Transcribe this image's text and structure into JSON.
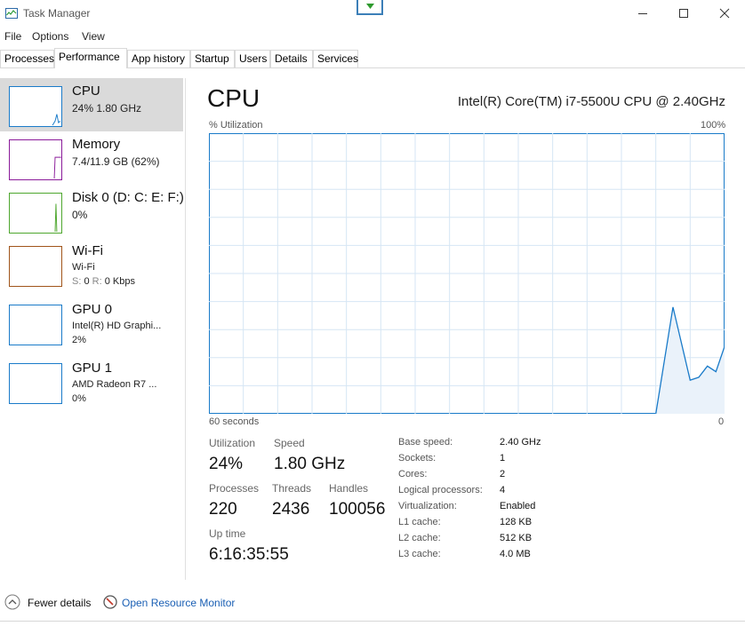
{
  "window": {
    "title": "Task Manager"
  },
  "menu": [
    "File",
    "Options",
    "View"
  ],
  "tabs": [
    "Processes",
    "Performance",
    "App history",
    "Startup",
    "Users",
    "Details",
    "Services"
  ],
  "sidebar": [
    {
      "name": "CPU",
      "line1": "24%  1.80 GHz",
      "color": "#1a7bc9"
    },
    {
      "name": "Memory",
      "line1": "7.4/11.9 GB (62%)",
      "color": "#8b1b9a"
    },
    {
      "name": "Disk 0 (D: C: E: F:)",
      "line1": "0%",
      "color": "#4ea72e"
    },
    {
      "name": "Wi-Fi",
      "line1": "Wi-Fi",
      "line2_s": "S:",
      "line2_sv": "0",
      "line2_r": "R:",
      "line2_rv": "0 Kbps",
      "color": "#a0541a"
    },
    {
      "name": "GPU 0",
      "line1": "Intel(R) HD Graphi...",
      "line2": "2%",
      "color": "#1a7bc9"
    },
    {
      "name": "GPU 1",
      "line1": "AMD Radeon R7 ...",
      "line2": "0%",
      "color": "#1a7bc9"
    }
  ],
  "main": {
    "title": "CPU",
    "model": "Intel(R) Core(TM) i7-5500U CPU @ 2.40GHz",
    "util_label": "% Utilization",
    "util_max": "100%",
    "time_label": "60 seconds",
    "time_zero": "0"
  },
  "chart_data": {
    "type": "area",
    "title": "CPU",
    "ylabel": "% Utilization",
    "xlabel": "60 seconds",
    "ylim": [
      0,
      100
    ],
    "x_seconds_ago": [
      8,
      6,
      4,
      3,
      2,
      1,
      0
    ],
    "values": [
      0,
      38,
      12,
      13,
      17,
      15,
      24
    ],
    "grid": true,
    "color": "#1a7bc9"
  },
  "stats": {
    "utilization_label": "Utilization",
    "utilization": "24%",
    "speed_label": "Speed",
    "speed": "1.80 GHz",
    "processes_label": "Processes",
    "processes": "220",
    "threads_label": "Threads",
    "threads": "2436",
    "handles_label": "Handles",
    "handles": "100056",
    "uptime_label": "Up time",
    "uptime": "6:16:35:55"
  },
  "specs": [
    {
      "label": "Base speed:",
      "value": "2.40 GHz"
    },
    {
      "label": "Sockets:",
      "value": "1"
    },
    {
      "label": "Cores:",
      "value": "2"
    },
    {
      "label": "Logical processors:",
      "value": "4"
    },
    {
      "label": "Virtualization:",
      "value": "Enabled"
    },
    {
      "label": "L1 cache:",
      "value": "128 KB"
    },
    {
      "label": "L2 cache:",
      "value": "512 KB"
    },
    {
      "label": "L3 cache:",
      "value": "4.0 MB"
    }
  ],
  "footer": {
    "fewer": "Fewer details",
    "resmon": "Open Resource Monitor",
    "link_color": "#1a5fb4"
  }
}
